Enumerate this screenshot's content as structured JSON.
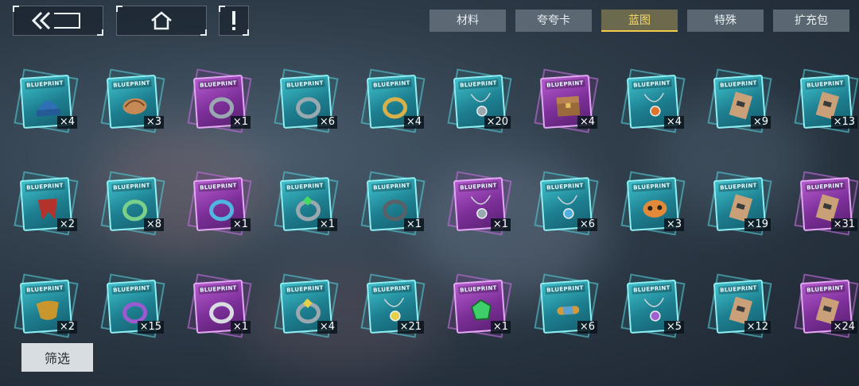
{
  "nav": {
    "back_icon": "double-chevron-left-icon",
    "home_icon": "home-icon",
    "info_icon": "exclamation-icon"
  },
  "tabs": [
    {
      "label": "材料",
      "active": false
    },
    {
      "label": "夸夸卡",
      "active": false
    },
    {
      "label": "蓝图",
      "active": true
    },
    {
      "label": "特殊",
      "active": false
    },
    {
      "label": "扩充包",
      "active": false
    }
  ],
  "colors": {
    "accent": "#f2cc4a",
    "blueprint_cyan": "#3fc0cc",
    "blueprint_purple": "#b65bd0"
  },
  "card_label": "BLUEPRINT",
  "items": [
    {
      "rarity": "cyan",
      "icon": "beanie-hat-icon",
      "qty": "×4"
    },
    {
      "rarity": "cyan",
      "icon": "cap-hat-icon",
      "qty": "×3"
    },
    {
      "rarity": "purple",
      "icon": "ring-icon",
      "qty": "×1"
    },
    {
      "rarity": "cyan",
      "icon": "ring-icon",
      "qty": "×6"
    },
    {
      "rarity": "cyan",
      "icon": "gold-ring-icon",
      "qty": "×4"
    },
    {
      "rarity": "cyan",
      "icon": "pendant-necklace-icon",
      "qty": "×20"
    },
    {
      "rarity": "purple",
      "icon": "treasure-chest-icon",
      "qty": "×4"
    },
    {
      "rarity": "cyan",
      "icon": "orange-pendant-icon",
      "qty": "×4"
    },
    {
      "rarity": "cyan",
      "icon": "ticket-icon",
      "qty": "×9"
    },
    {
      "rarity": "cyan",
      "icon": "ticket-icon",
      "qty": "×13"
    },
    {
      "rarity": "cyan",
      "icon": "red-scarf-icon",
      "qty": "×2"
    },
    {
      "rarity": "cyan",
      "icon": "green-ring-icon",
      "qty": "×8"
    },
    {
      "rarity": "purple",
      "icon": "blue-ring-icon",
      "qty": "×1"
    },
    {
      "rarity": "cyan",
      "icon": "gem-ring-icon",
      "qty": "×1"
    },
    {
      "rarity": "cyan",
      "icon": "dark-ring-icon",
      "qty": "×1"
    },
    {
      "rarity": "purple",
      "icon": "chain-necklace-icon",
      "qty": "×1"
    },
    {
      "rarity": "cyan",
      "icon": "blue-pendant-icon",
      "qty": "×6"
    },
    {
      "rarity": "cyan",
      "icon": "mask-icon",
      "qty": "×3"
    },
    {
      "rarity": "cyan",
      "icon": "ticket-icon",
      "qty": "×19"
    },
    {
      "rarity": "purple",
      "icon": "ticket-icon",
      "qty": "×31"
    },
    {
      "rarity": "cyan",
      "icon": "face-mask-icon",
      "qty": "×2"
    },
    {
      "rarity": "cyan",
      "icon": "purple-ring-icon",
      "qty": "×15"
    },
    {
      "rarity": "purple",
      "icon": "silver-ring-icon",
      "qty": "×1"
    },
    {
      "rarity": "cyan",
      "icon": "yellow-gem-ring-icon",
      "qty": "×4"
    },
    {
      "rarity": "cyan",
      "icon": "yellow-pendant-icon",
      "qty": "×21"
    },
    {
      "rarity": "purple",
      "icon": "green-gem-icon",
      "qty": "×1"
    },
    {
      "rarity": "cyan",
      "icon": "bracelet-icon",
      "qty": "×6"
    },
    {
      "rarity": "cyan",
      "icon": "purple-pendant-icon",
      "qty": "×5"
    },
    {
      "rarity": "cyan",
      "icon": "ticket-icon",
      "qty": "×12"
    },
    {
      "rarity": "purple",
      "icon": "ticket-icon",
      "qty": "×24"
    }
  ],
  "filter": {
    "label": "筛选"
  }
}
